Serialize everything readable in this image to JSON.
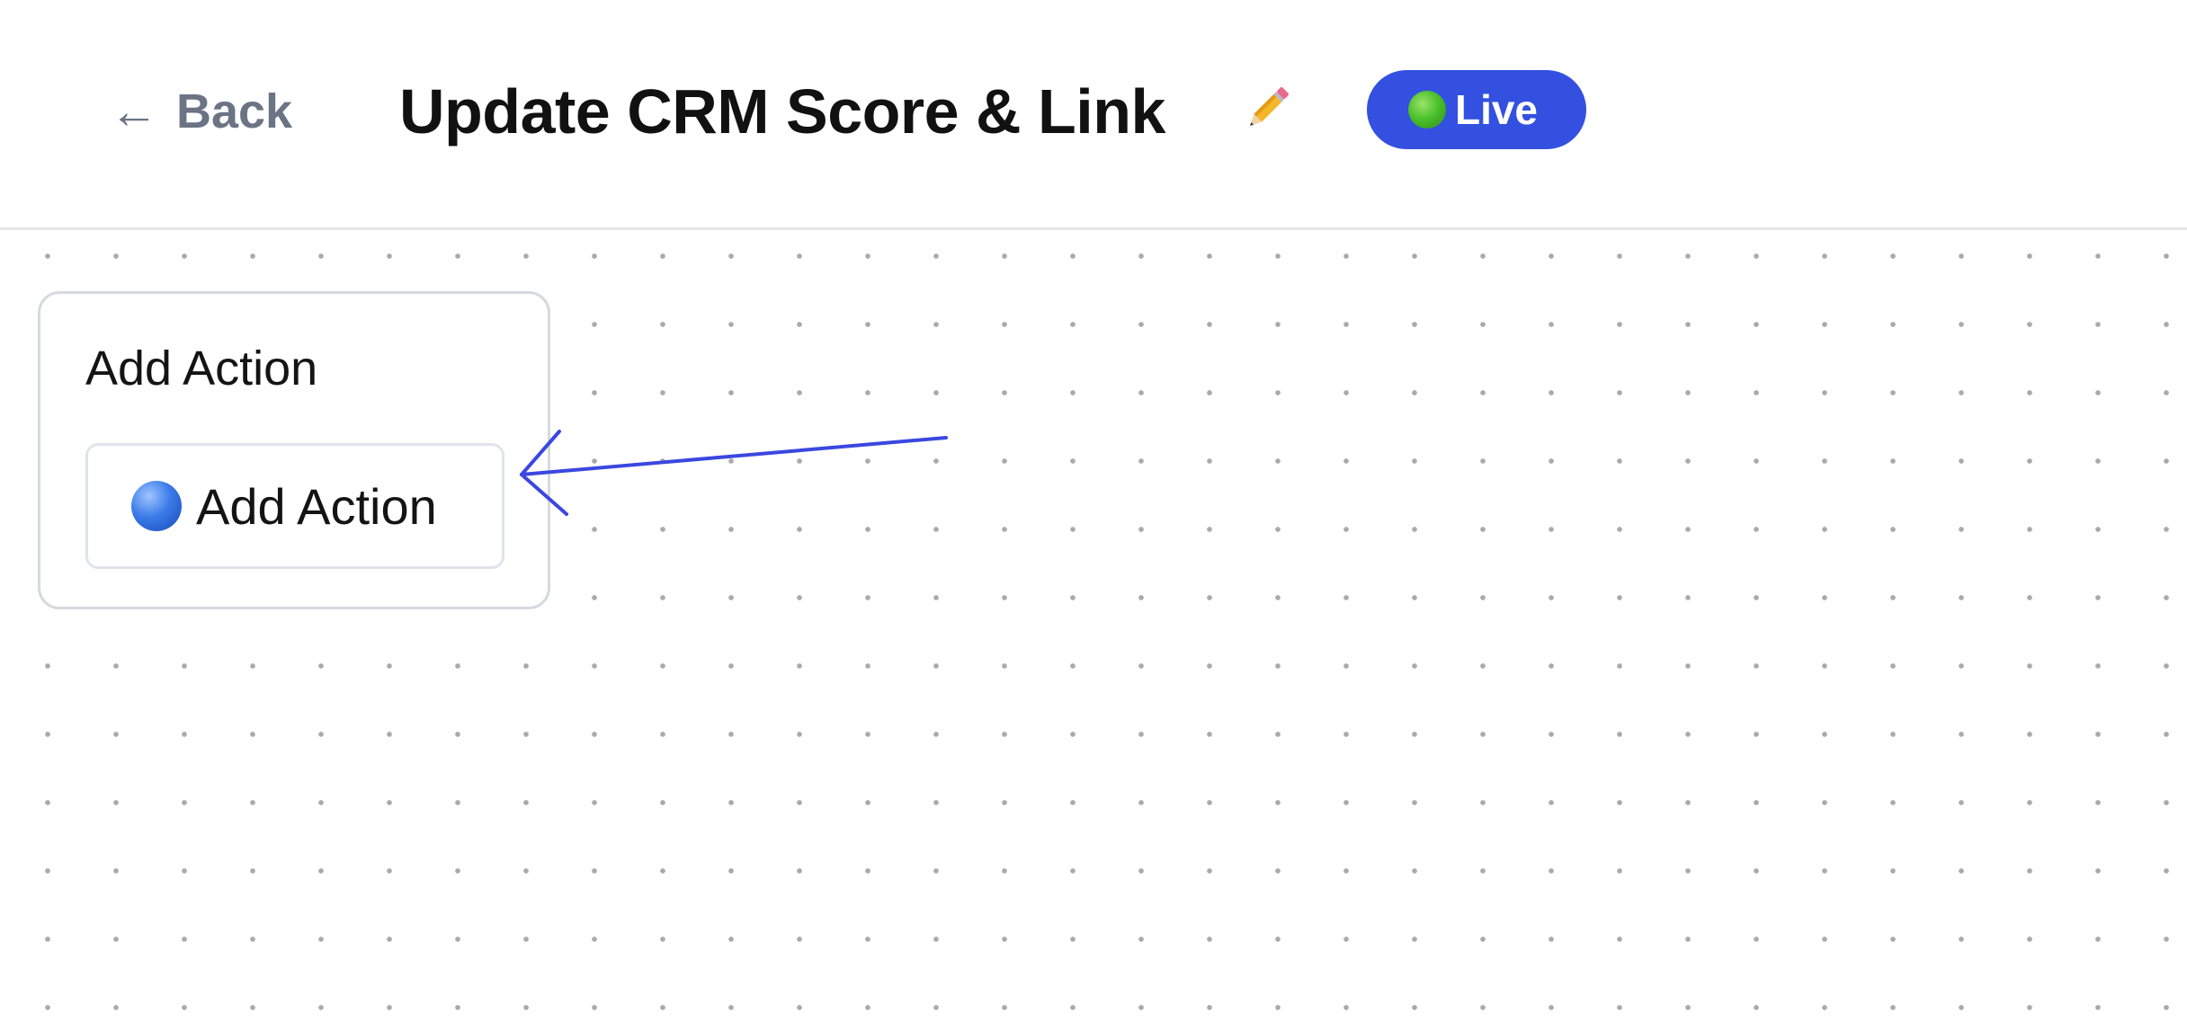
{
  "header": {
    "back_label": "Back",
    "back_arrow": "←",
    "title": "Update CRM Score & Link",
    "edit_icon": "pencil-icon",
    "status": {
      "label": "Live",
      "icon": "green-circle-icon",
      "color": "#3450e0"
    }
  },
  "canvas": {
    "node": {
      "title": "Add Action",
      "button_label": "Add Action",
      "button_icon": "blue-circle-icon"
    },
    "annotation": {
      "icon": "arrow-icon",
      "color": "#3b47e0"
    }
  }
}
